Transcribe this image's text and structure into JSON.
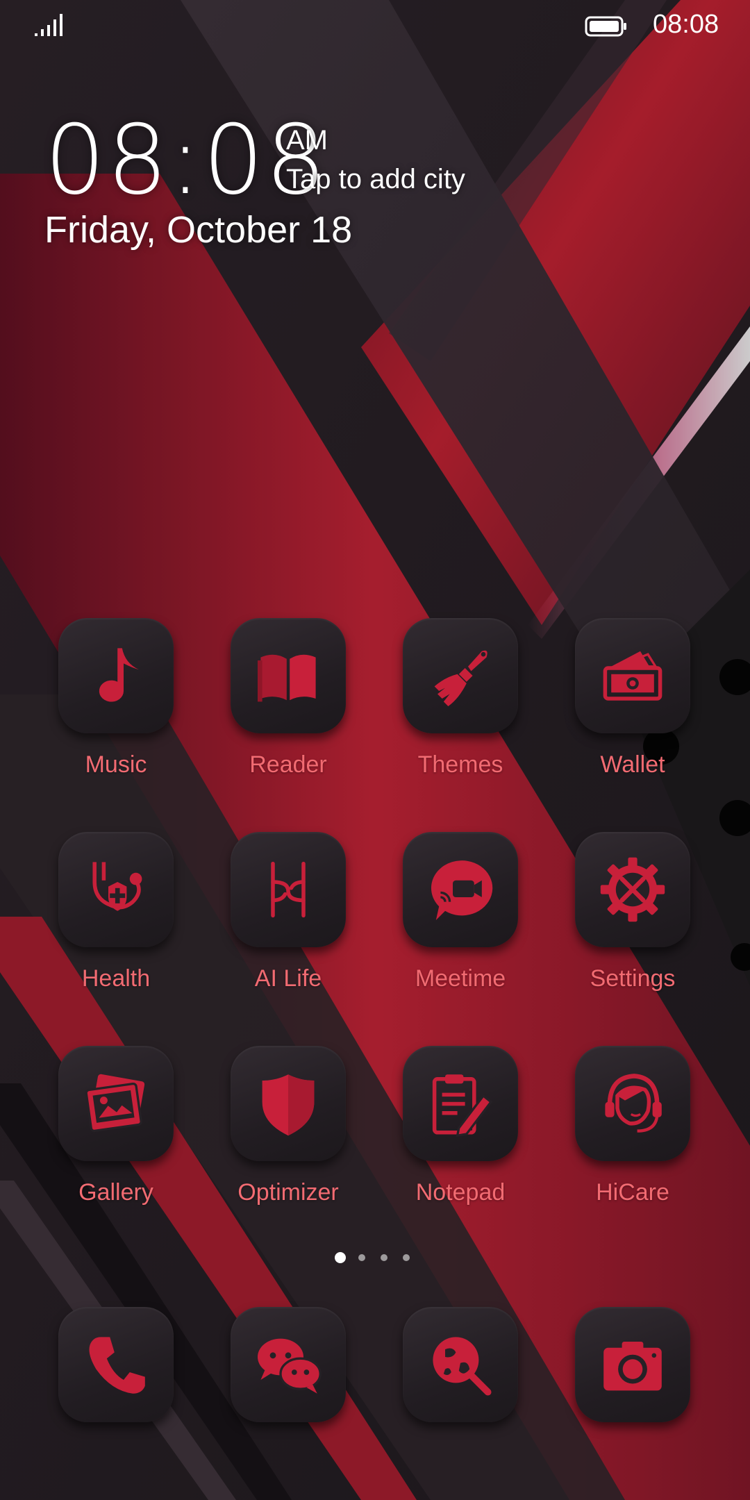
{
  "status_bar": {
    "time": "08:08"
  },
  "clock_widget": {
    "time": "08:08",
    "ampm": "AM",
    "city_prompt": "Tap to add city",
    "date": "Friday, October 18"
  },
  "apps": [
    {
      "label": "Music",
      "icon": "music-note-icon"
    },
    {
      "label": "Reader",
      "icon": "book-icon"
    },
    {
      "label": "Themes",
      "icon": "paint-brush-icon"
    },
    {
      "label": "Wallet",
      "icon": "wallet-icon"
    },
    {
      "label": "Health",
      "icon": "stethoscope-icon"
    },
    {
      "label": "AI Life",
      "icon": "ai-life-icon"
    },
    {
      "label": "Meetime",
      "icon": "video-chat-icon"
    },
    {
      "label": "Settings",
      "icon": "gear-icon"
    },
    {
      "label": "Gallery",
      "icon": "photo-icon"
    },
    {
      "label": "Optimizer",
      "icon": "shield-icon"
    },
    {
      "label": "Notepad",
      "icon": "clipboard-pencil-icon"
    },
    {
      "label": "HiCare",
      "icon": "headset-icon"
    }
  ],
  "page_indicator": {
    "count": 4,
    "active_index": 0
  },
  "dock": [
    {
      "icon": "phone-icon"
    },
    {
      "icon": "chat-bubbles-icon"
    },
    {
      "icon": "browser-globe-icon"
    },
    {
      "icon": "camera-icon"
    }
  ],
  "colors": {
    "accent": "#d0223a",
    "label": "#f26b72",
    "icon_tile": "#262126"
  }
}
